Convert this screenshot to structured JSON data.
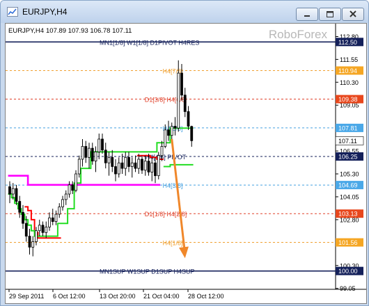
{
  "window": {
    "title": "EURJPY,H4",
    "min_icon": "minimize-icon",
    "max_icon": "maximize-icon",
    "close_icon": "close-icon"
  },
  "chart_info": {
    "symbol": "EURJPY,H4",
    "ohlc": "107.89 107.93 106.78 107.11",
    "watermark": "RoboForex"
  },
  "chart_data": {
    "type": "candlestick",
    "ylim": [
      99.0,
      113.5
    ],
    "price_ticks": [
      "112.80",
      "111.55",
      "110.30",
      "109.05",
      "107.80",
      "106.55",
      "105.30",
      "104.05",
      "102.80",
      "101.55",
      "100.30",
      "99.05"
    ],
    "time_labels": [
      "29 Sep 2011",
      "6 Oct 12:00",
      "13 Oct 20:00",
      "21 Oct 04:00",
      "28 Oct 12:00"
    ],
    "murrey_levels": [
      {
        "label": "MN1[1/8] W1[1/8] D1PIVOT H4RES",
        "price": 112.5,
        "price_label": "112.50",
        "style": "solid",
        "color": "#14205a",
        "badge_color": "#14205a"
      },
      {
        "label": "H4[7/8]",
        "price": 110.94,
        "price_label": "110.94",
        "style": "dashed",
        "color": "#f0a030",
        "badge_color": "#f5a623"
      },
      {
        "label": "D1[3/8] H4[6/8]",
        "price": 109.38,
        "price_label": "109.38",
        "style": "dashed",
        "color": "#e0402a",
        "badge_color": "#e8471c"
      },
      {
        "label": "H4[5/8]",
        "price": 107.81,
        "price_label": "107.81",
        "style": "dashed",
        "color": "#44a0e0",
        "badge_color": "#4aa8e8"
      },
      {
        "label": "H4[4/8] PIVOT",
        "price": 106.25,
        "price_label": "106.25",
        "style": "dashed",
        "color": "#14205a",
        "badge_color": "#14205a"
      },
      {
        "label": "H4[3/8]",
        "price": 104.69,
        "price_label": "104.69",
        "style": "dashed",
        "color": "#44a0e0",
        "badge_color": "#4aa8e8"
      },
      {
        "label": "D1[1/8] H4[2/8]",
        "price": 103.13,
        "price_label": "103.13",
        "style": "dashed",
        "color": "#e0402a",
        "badge_color": "#e8471c"
      },
      {
        "label": "H4[1/8]",
        "price": 101.56,
        "price_label": "101.56",
        "style": "dashed",
        "color": "#f0a030",
        "badge_color": "#f5a623"
      },
      {
        "label": "MN1SUP W1SUP D1SUP H4SUP",
        "price": 100.0,
        "price_label": "100.00",
        "style": "solid",
        "color": "#14205a",
        "badge_color": "#14205a"
      }
    ],
    "current_price": {
      "price": 107.11,
      "label": "107.11"
    },
    "candles": [
      [
        104.6,
        104.9,
        103.7,
        104.2
      ],
      [
        104.2,
        104.8,
        103.9,
        104.5
      ],
      [
        104.5,
        104.7,
        103.6,
        103.8
      ],
      [
        103.8,
        104.1,
        102.9,
        103.2
      ],
      [
        103.2,
        103.6,
        102.3,
        102.6
      ],
      [
        102.6,
        103.0,
        101.6,
        101.9
      ],
      [
        101.9,
        102.3,
        100.9,
        101.3
      ],
      [
        101.3,
        101.9,
        100.8,
        101.6
      ],
      [
        101.6,
        102.4,
        101.4,
        102.2
      ],
      [
        102.2,
        102.8,
        101.9,
        102.5
      ],
      [
        102.5,
        102.7,
        101.9,
        102.1
      ],
      [
        102.1,
        102.7,
        101.8,
        102.4
      ],
      [
        102.4,
        103.2,
        102.2,
        102.9
      ],
      [
        102.9,
        103.4,
        102.5,
        102.7
      ],
      [
        102.7,
        103.3,
        102.5,
        103.1
      ],
      [
        103.1,
        103.7,
        102.9,
        103.5
      ],
      [
        103.5,
        104.1,
        103.3,
        103.9
      ],
      [
        103.9,
        104.4,
        103.6,
        104.2
      ],
      [
        104.2,
        104.9,
        104.0,
        104.7
      ],
      [
        104.7,
        104.9,
        104.2,
        104.4
      ],
      [
        104.4,
        105.5,
        104.3,
        105.3
      ],
      [
        105.3,
        106.3,
        105.1,
        106.1
      ],
      [
        106.1,
        107.2,
        105.7,
        106.8
      ],
      [
        106.8,
        107.1,
        105.9,
        106.2
      ],
      [
        106.2,
        107.0,
        105.6,
        106.7
      ],
      [
        106.7,
        107.0,
        105.8,
        106.0
      ],
      [
        106.0,
        106.8,
        105.4,
        106.5
      ],
      [
        106.5,
        107.5,
        106.1,
        107.2
      ],
      [
        107.2,
        107.5,
        106.4,
        106.6
      ],
      [
        106.6,
        107.0,
        105.6,
        105.9
      ],
      [
        105.9,
        106.5,
        105.2,
        106.2
      ],
      [
        106.2,
        106.6,
        105.4,
        105.7
      ],
      [
        105.7,
        106.1,
        104.9,
        105.3
      ],
      [
        105.3,
        106.2,
        105.1,
        105.9
      ],
      [
        105.9,
        106.4,
        105.3,
        105.6
      ],
      [
        105.6,
        106.5,
        105.2,
        106.2
      ],
      [
        106.2,
        106.5,
        105.4,
        105.7
      ],
      [
        105.7,
        106.2,
        105.1,
        105.9
      ],
      [
        105.9,
        106.3,
        105.4,
        105.6
      ],
      [
        105.6,
        106.4,
        105.3,
        106.1
      ],
      [
        106.1,
        106.3,
        105.3,
        105.5
      ],
      [
        105.5,
        106.3,
        105.2,
        106.0
      ],
      [
        106.0,
        106.4,
        105.2,
        105.4
      ],
      [
        105.4,
        106.2,
        104.9,
        105.9
      ],
      [
        105.9,
        106.2,
        104.8,
        105.2
      ],
      [
        105.2,
        106.5,
        105.0,
        106.3
      ],
      [
        106.3,
        107.1,
        106.0,
        106.8
      ],
      [
        106.8,
        108.0,
        106.7,
        107.7
      ],
      [
        107.7,
        108.2,
        107.1,
        107.4
      ],
      [
        107.4,
        108.1,
        107.0,
        107.9
      ],
      [
        107.9,
        108.4,
        107.4,
        107.8
      ],
      [
        107.8,
        111.5,
        107.6,
        110.8
      ],
      [
        110.8,
        111.3,
        109.3,
        109.6
      ],
      [
        109.6,
        110.0,
        108.4,
        108.7
      ],
      [
        108.7,
        109.0,
        107.7,
        107.9
      ],
      [
        107.89,
        107.93,
        106.78,
        107.11
      ]
    ],
    "series": [
      {
        "name": "magenta_level",
        "color": "#ff00ff",
        "values": [
          105.2,
          105.2,
          105.2,
          105.2,
          105.2,
          105.2,
          104.7,
          104.7,
          104.7,
          104.7,
          104.7,
          104.7,
          104.7,
          104.7,
          104.7,
          104.7,
          104.7,
          104.7,
          104.7,
          104.7,
          104.7,
          104.7,
          104.7,
          104.7,
          104.7,
          104.7,
          104.7,
          104.7,
          104.7,
          104.7,
          104.7,
          104.7,
          104.7,
          104.7,
          104.7,
          104.7,
          104.7,
          104.7,
          104.7,
          104.7,
          104.7,
          104.7,
          104.7,
          104.7,
          104.7,
          104.7
        ]
      },
      {
        "name": "red_line",
        "color": "#ff0000",
        "values": [
          null,
          null,
          null,
          null,
          null,
          103.5,
          103.3,
          102.8,
          102.1,
          101.8,
          101.8,
          101.8,
          101.8,
          101.8,
          101.8,
          101.8,
          null,
          null,
          null,
          null,
          null,
          null,
          null,
          null,
          null,
          null,
          null,
          null,
          null,
          null,
          null,
          null,
          null,
          null,
          null,
          null,
          null,
          null,
          null,
          106.3,
          106.3,
          106.3,
          106.3,
          106.2,
          106.2,
          106.1,
          106.1
        ]
      },
      {
        "name": "green_line",
        "color": "#22dd22",
        "values": [
          104.2,
          104.0,
          103.7,
          103.4,
          103.1,
          102.8,
          102.5,
          102.2,
          101.9,
          101.9,
          101.9,
          101.9,
          101.9,
          101.9,
          101.9,
          102.6,
          102.6,
          102.6,
          103.4,
          103.4,
          104.8,
          104.8,
          105.6,
          105.6,
          105.6,
          106.5,
          106.5,
          106.5,
          106.5,
          106.5,
          106.5,
          106.5,
          106.5,
          106.5,
          106.5,
          106.5,
          106.5,
          106.5,
          106.5,
          106.5,
          106.5,
          106.5,
          106.5,
          106.5,
          106.5,
          107.0,
          107.0,
          107.0,
          107.0,
          107.8,
          107.8,
          107.8,
          107.8,
          107.8,
          107.8,
          107.8
        ]
      },
      {
        "name": "green_line_2",
        "color": "#22dd22",
        "values": [
          null,
          null,
          null,
          null,
          null,
          null,
          null,
          null,
          null,
          null,
          null,
          null,
          null,
          null,
          null,
          null,
          null,
          null,
          null,
          null,
          null,
          null,
          null,
          null,
          null,
          null,
          null,
          null,
          null,
          null,
          null,
          null,
          null,
          null,
          null,
          null,
          null,
          null,
          null,
          null,
          null,
          null,
          null,
          null,
          null,
          null,
          null,
          105.7,
          105.7,
          105.8,
          105.8,
          105.8,
          105.8,
          105.8,
          105.8,
          105.8
        ]
      }
    ],
    "forecast_arrow": {
      "from": [
        49,
        107.2
      ],
      "to": [
        53,
        100.7
      ],
      "color": "#f0872a"
    }
  }
}
